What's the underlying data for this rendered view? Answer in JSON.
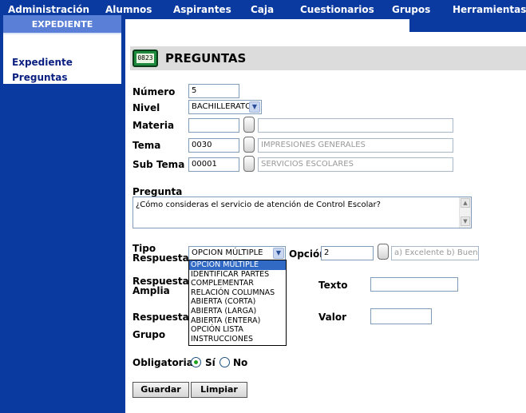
{
  "topnav": {
    "items": [
      "Administración",
      "Alumnos",
      "Aspirantes",
      "Caja",
      "Cuestionarios",
      "Grupos",
      "Herramientas"
    ]
  },
  "sidebar": {
    "header": "EXPEDIENTE",
    "links": [
      "Expediente",
      "Preguntas"
    ]
  },
  "page": {
    "icon_text": "0823",
    "title": "PREGUNTAS"
  },
  "form": {
    "numero": {
      "label": "Número",
      "value": "5"
    },
    "nivel": {
      "label": "Nivel",
      "value": "BACHILLERATO"
    },
    "materia": {
      "label": "Materia",
      "code": "",
      "description": ""
    },
    "tema": {
      "label": "Tema",
      "code": "0030",
      "description": "IMPRESIONES GENERALES"
    },
    "subtema": {
      "label": "Sub Tema",
      "code": "00001",
      "description": "SERVICIOS ESCOLARES"
    },
    "pregunta": {
      "label": "Pregunta",
      "value": "¿Cómo consideras el servicio de atención de Control Escolar?"
    },
    "tipo_respuesta": {
      "label_line1": "Tipo",
      "label_line2": "Respuesta",
      "value": "OPCION MÚLTIPLE",
      "options": [
        "OPCION MÚLTIPLE",
        "IDENTIFICAR PARTES",
        "COMPLEMENTAR",
        "RELACIÓN COLUMNAS",
        "ABIERTA (CORTA)",
        "ABIERTA (LARGA)",
        "ABIERTA (ENTERA)",
        "OPCIÓN LISTA",
        "INSTRUCCIONES"
      ]
    },
    "opcion": {
      "label": "Opción",
      "value": "2",
      "description": "a) Excelente b) Bueno c"
    },
    "respuesta_amplia": {
      "label_line1": "Respuesta",
      "label_line2": "Amplia"
    },
    "texto": {
      "label": "Texto",
      "value": ""
    },
    "respuesta": {
      "label": "Respuesta"
    },
    "valor": {
      "label": "Valor",
      "value": ""
    },
    "grupo": {
      "label": "Grupo"
    },
    "obligatoria": {
      "label": "Obligatoria",
      "yes": "Sí",
      "no": "No",
      "selected": "Sí"
    }
  },
  "buttons": {
    "save": "Guardar",
    "clear": "Limpiar"
  }
}
